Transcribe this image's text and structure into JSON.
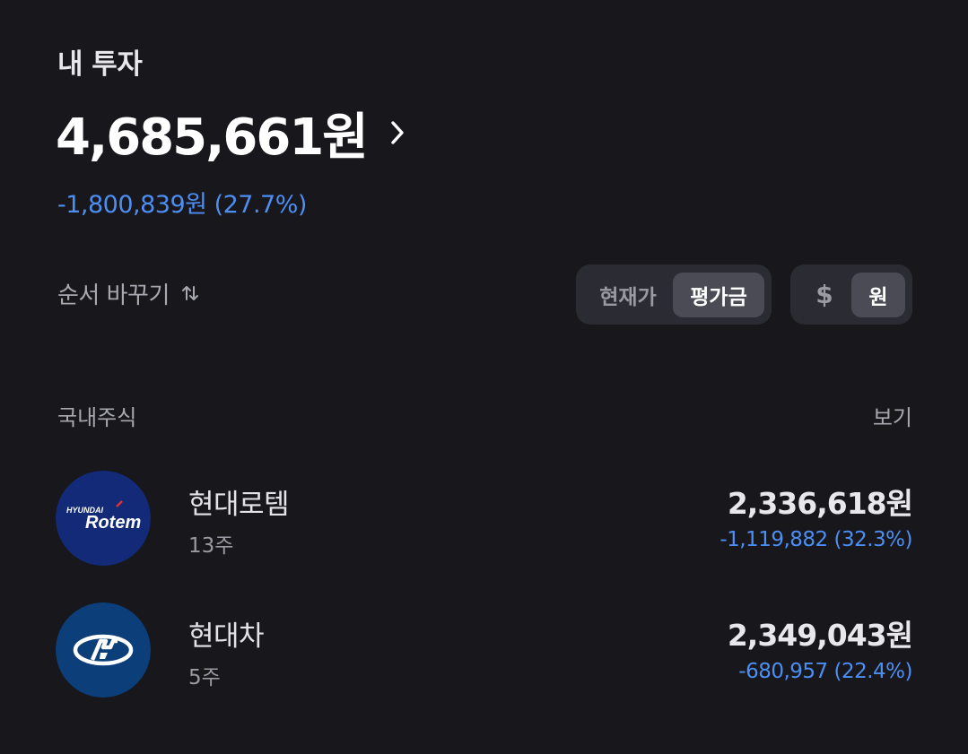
{
  "header": {
    "title": "내 투자"
  },
  "summary": {
    "total": "4,685,661원",
    "change": "-1,800,839원 (27.7%)"
  },
  "controls": {
    "sort_label": "순서 바꾸기",
    "view_toggle": [
      {
        "label": "현재가",
        "active": false
      },
      {
        "label": "평가금",
        "active": true
      }
    ],
    "currency_toggle": [
      {
        "label": "$",
        "active": false
      },
      {
        "label": "원",
        "active": true
      }
    ]
  },
  "section": {
    "title": "국내주식",
    "link": "보기"
  },
  "stocks": [
    {
      "name": "현대로템",
      "quantity": "13주",
      "value": "2,336,618원",
      "change": "-1,119,882 (32.3%)",
      "logo": {
        "name": "hyundai-rotem-logo",
        "brand_top": "HYUNDAI",
        "brand_main": "Rotem",
        "bg": "#132a78"
      }
    },
    {
      "name": "현대차",
      "quantity": "5주",
      "value": "2,349,043원",
      "change": "-680,957 (22.4%)",
      "logo": {
        "name": "hyundai-logo",
        "bg": "#0c3f7a"
      }
    }
  ],
  "colors": {
    "background": "#17171c",
    "loss_blue": "#4d8ef3",
    "segment_bg": "#2b2b33",
    "segment_active": "#4b4b55"
  }
}
